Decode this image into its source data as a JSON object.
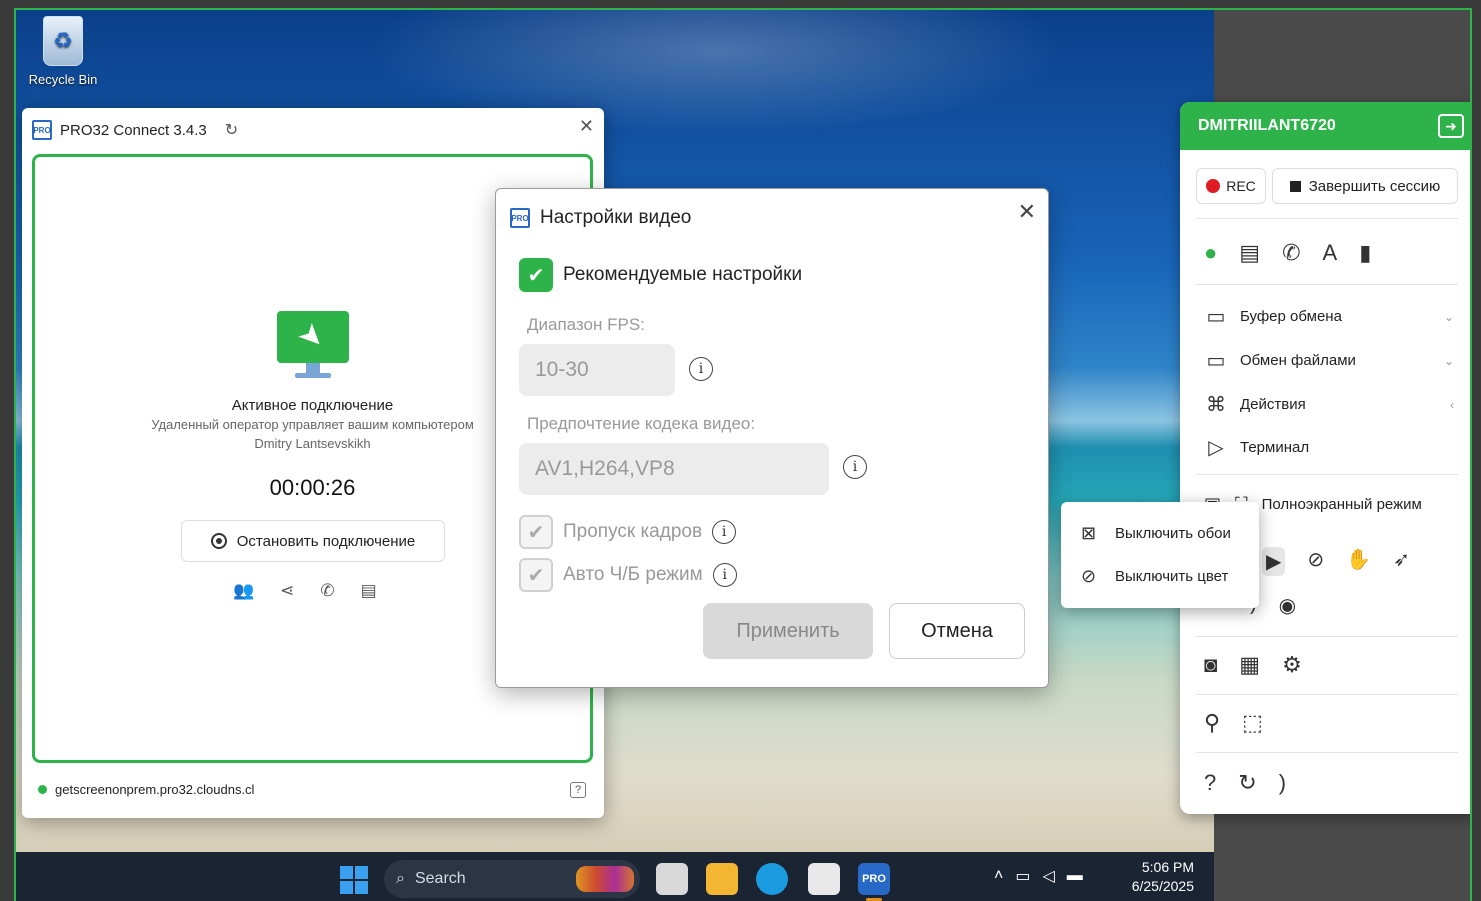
{
  "desktop": {
    "icons": [
      {
        "label": "Recycle Bin",
        "icon": "recycle-bin-icon"
      }
    ]
  },
  "taskbar": {
    "search_label": "Search",
    "clock_time": "5:06 PM",
    "clock_date": "6/25/2025",
    "pinned_apps": [
      "task-view",
      "file-explorer",
      "edge",
      "store",
      "pro32-connect"
    ]
  },
  "connect_window": {
    "title": "PRO32 Connect 3.4.3",
    "status_title": "Активное подключение",
    "status_subtitle": "Удаленный оператор управляет вашим компьютером",
    "operator_name": "Dmitry Lantsevskikh",
    "timer": "00:00:26",
    "stop_button": "Остановить подключение",
    "server": "getscreenonprem.pro32.cloudns.cl",
    "accent": "#2db34a"
  },
  "video_dialog": {
    "title": "Настройки видео",
    "recommended_label": "Рекомендуемые настройки",
    "recommended_checked": true,
    "fps_label": "Диапазон FPS:",
    "fps_value": "10-30",
    "codec_label": "Предпочтение кодека видео:",
    "codec_value": "AV1,H264,VP8",
    "frame_skip_label": "Пропуск кадров",
    "frame_skip_checked": true,
    "auto_bw_label": "Авто Ч/Б режим",
    "auto_bw_checked": true,
    "apply_button": "Применить",
    "cancel_button": "Отмена"
  },
  "control_panel": {
    "device_name": "DMITRIILANT6720",
    "rec_button": "REC",
    "end_session_button": "Завершить сессию",
    "menu": [
      {
        "label": "Буфер обмена",
        "icon": "clipboard-icon"
      },
      {
        "label": "Обмен файлами",
        "icon": "folder-icon"
      },
      {
        "label": "Действия",
        "icon": "command-icon"
      },
      {
        "label": "Терминал",
        "icon": "terminal-icon"
      }
    ],
    "fullscreen_label": "Полноэкранный режим",
    "header_color": "#2db34a"
  },
  "popup_menu": {
    "items": [
      {
        "label": "Выключить обои",
        "icon": "no-wallpaper-icon"
      },
      {
        "label": "Выключить цвет",
        "icon": "no-color-icon"
      }
    ]
  }
}
